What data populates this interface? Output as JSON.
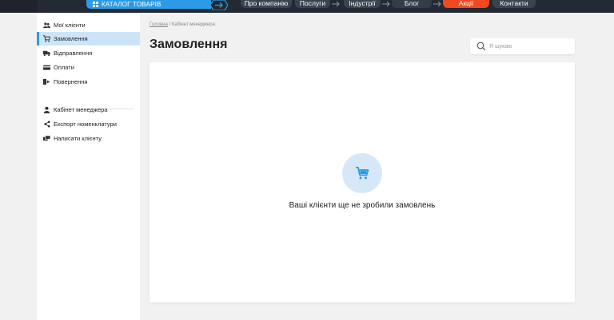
{
  "header": {
    "catalog_label": "КАТАЛОГ ТОВАРІВ",
    "nav": [
      {
        "label": "Про компанію"
      },
      {
        "label": "Послуги"
      },
      {
        "label": "Індустрії"
      },
      {
        "label": "Блог"
      },
      {
        "label": "Акції"
      },
      {
        "label": "Контакти"
      }
    ],
    "colors": {
      "bar": "#242a33",
      "accent": "#2c9be6",
      "promo": "#f04a23"
    }
  },
  "sidebar": {
    "items": [
      {
        "label": "Мої клієнти",
        "icon": "users-icon"
      },
      {
        "label": "Замовлення",
        "icon": "cart-icon",
        "active": true
      },
      {
        "label": "Відправлення",
        "icon": "truck-icon"
      },
      {
        "label": "Оплати",
        "icon": "card-icon"
      },
      {
        "label": "Повернення",
        "icon": "return-icon"
      }
    ],
    "secondary": [
      {
        "label": "Кабінет менеджера",
        "icon": "user-icon"
      },
      {
        "label": "Експорт номенклатури",
        "icon": "export-icon"
      },
      {
        "label": "Написати клієнту",
        "icon": "chat-icon"
      }
    ]
  },
  "breadcrumb": {
    "home": "Головна",
    "separator": "/",
    "current": "Кабінет менеджера"
  },
  "page": {
    "title": "Замовлення"
  },
  "search": {
    "placeholder": "Я шукаю",
    "value": ""
  },
  "empty_state": {
    "icon": "cart-icon",
    "text": "Ваші клієнти ще не зробили замовлень"
  }
}
